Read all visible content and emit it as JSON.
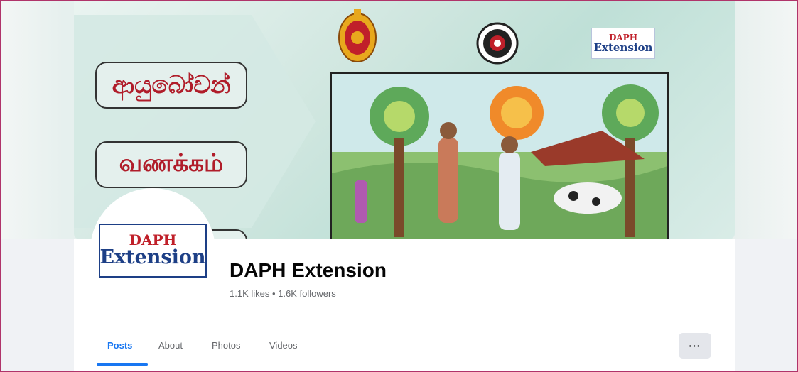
{
  "cover": {
    "greeting_sinhala": "ආයුබෝවන්",
    "greeting_tamil": "வணக்கம்",
    "logo_small": {
      "line1": "DAPH",
      "line2": "Extension"
    }
  },
  "profile": {
    "avatar_logo": {
      "line1": "DAPH",
      "line2": "Extension"
    },
    "name": "DAPH Extension",
    "stats": "1.1K likes • 1.6K followers"
  },
  "tabs": [
    {
      "label": "Posts",
      "active": true
    },
    {
      "label": "About",
      "active": false
    },
    {
      "label": "Photos",
      "active": false
    },
    {
      "label": "Videos",
      "active": false
    }
  ],
  "more_button": "···",
  "colors": {
    "accent": "#1877f2",
    "greeting_text": "#b01d2a",
    "logo_blue": "#1d3f86",
    "logo_red": "#c0202a"
  }
}
